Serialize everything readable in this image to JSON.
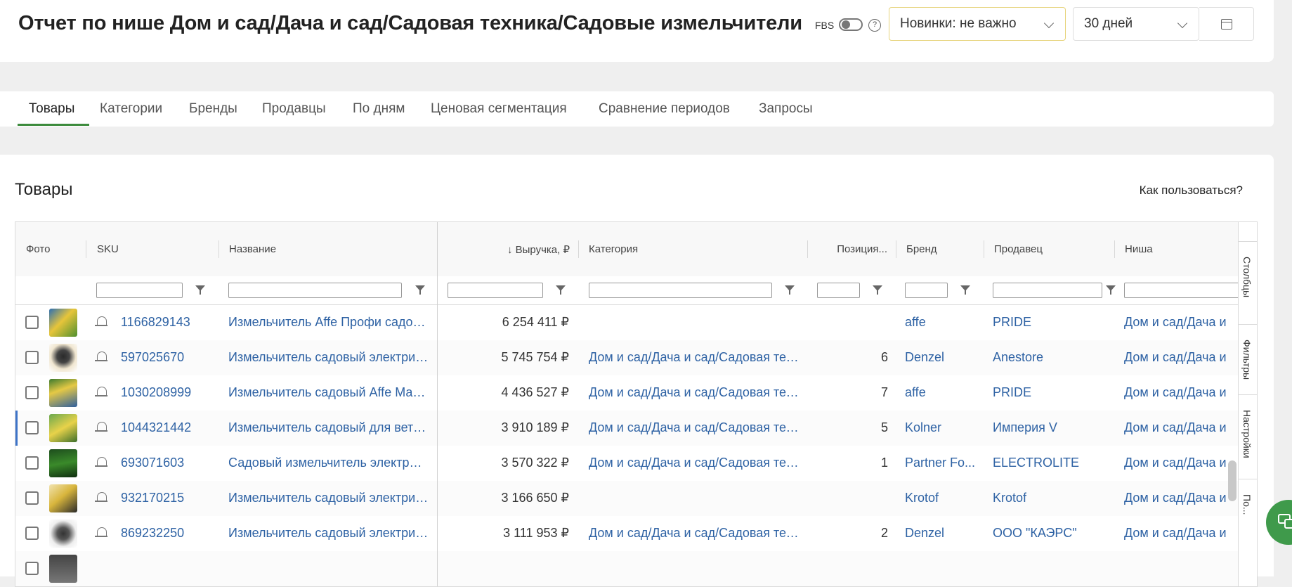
{
  "header": {
    "title": "Отчет по нише Дом и сад/Дача и сад/Садовая техника/Садовые измельчители",
    "fbs_label": "FBS",
    "help_icon": "?",
    "new_select": "Новинки: не важно",
    "period_select": "30 дней"
  },
  "tabs": [
    "Товары",
    "Категории",
    "Бренды",
    "Продавцы",
    "По дням",
    "Ценовая сегментация",
    "Сравнение периодов",
    "Запросы"
  ],
  "section": {
    "title": "Товары",
    "help_link": "Как пользоваться?"
  },
  "columns": {
    "photo": "Фото",
    "sku": "SKU",
    "name": "Название",
    "revenue": "↓ Выручка, ₽",
    "category": "Категория",
    "position": "Позиция...",
    "brand": "Бренд",
    "seller": "Продавец",
    "niche": "Ниша"
  },
  "rows": [
    {
      "sku": "1166829143",
      "name": "Измельчитель Affe Профи садов...",
      "revenue": "6 254 411 ₽",
      "category": "",
      "position": "",
      "brand": "affe",
      "seller": "PRIDE",
      "niche": "Дом и сад/Дача и"
    },
    {
      "sku": "597025670",
      "name": "Измельчитель садовый электрич...",
      "revenue": "5 745 754 ₽",
      "category": "Дом и сад/Дача и сад/Садовая тех...",
      "position": "6",
      "brand": "Denzel",
      "seller": "Anestore",
      "niche": "Дом и сад/Дача и"
    },
    {
      "sku": "1030208999",
      "name": "Измельчитель садовый Affe Маст...",
      "revenue": "4 436 527 ₽",
      "category": "Дом и сад/Дача и сад/Садовая тех...",
      "position": "7",
      "brand": "affe",
      "seller": "PRIDE",
      "niche": "Дом и сад/Дача и"
    },
    {
      "sku": "1044321442",
      "name": "Измельчитель садовый для веток...",
      "revenue": "3 910 189 ₽",
      "category": "Дом и сад/Дача и сад/Садовая тех...",
      "position": "5",
      "brand": "Kolner",
      "seller": "Империя V",
      "niche": "Дом и сад/Дача и"
    },
    {
      "sku": "693071603",
      "name": "Садовый измельчитель электрич...",
      "revenue": "3 570 322 ₽",
      "category": "Дом и сад/Дача и сад/Садовая тех...",
      "position": "1",
      "brand": "Partner Fo...",
      "seller": "ELECTROLITE",
      "niche": "Дом и сад/Дача и"
    },
    {
      "sku": "932170215",
      "name": "Измельчитель садовый электрич...",
      "revenue": "3 166 650 ₽",
      "category": "",
      "position": "",
      "brand": "Krotof",
      "seller": "Krotof",
      "niche": "Дом и сад/Дача и"
    },
    {
      "sku": "869232250",
      "name": "Измельчитель садовый электрич...",
      "revenue": "3 111 953 ₽",
      "category": "Дом и сад/Дача и сад/Садовая тех...",
      "position": "2",
      "brand": "Denzel",
      "seller": "ООО \"КАЭРС\"",
      "niche": "Дом и сад/Дача и"
    }
  ],
  "side_panel": [
    "Столбцы",
    "Фильтры",
    "Настройки",
    "По..."
  ],
  "colors": {
    "accent_green": "#3d8b3d",
    "link_blue": "#2e62a4",
    "chat_button": "#3f9a4b"
  },
  "icons": [
    "help-icon",
    "chevron-down-icon",
    "calendar-icon",
    "filter-icon",
    "bell-icon",
    "chat-icon",
    "columns-icon",
    "settings-icon"
  ]
}
